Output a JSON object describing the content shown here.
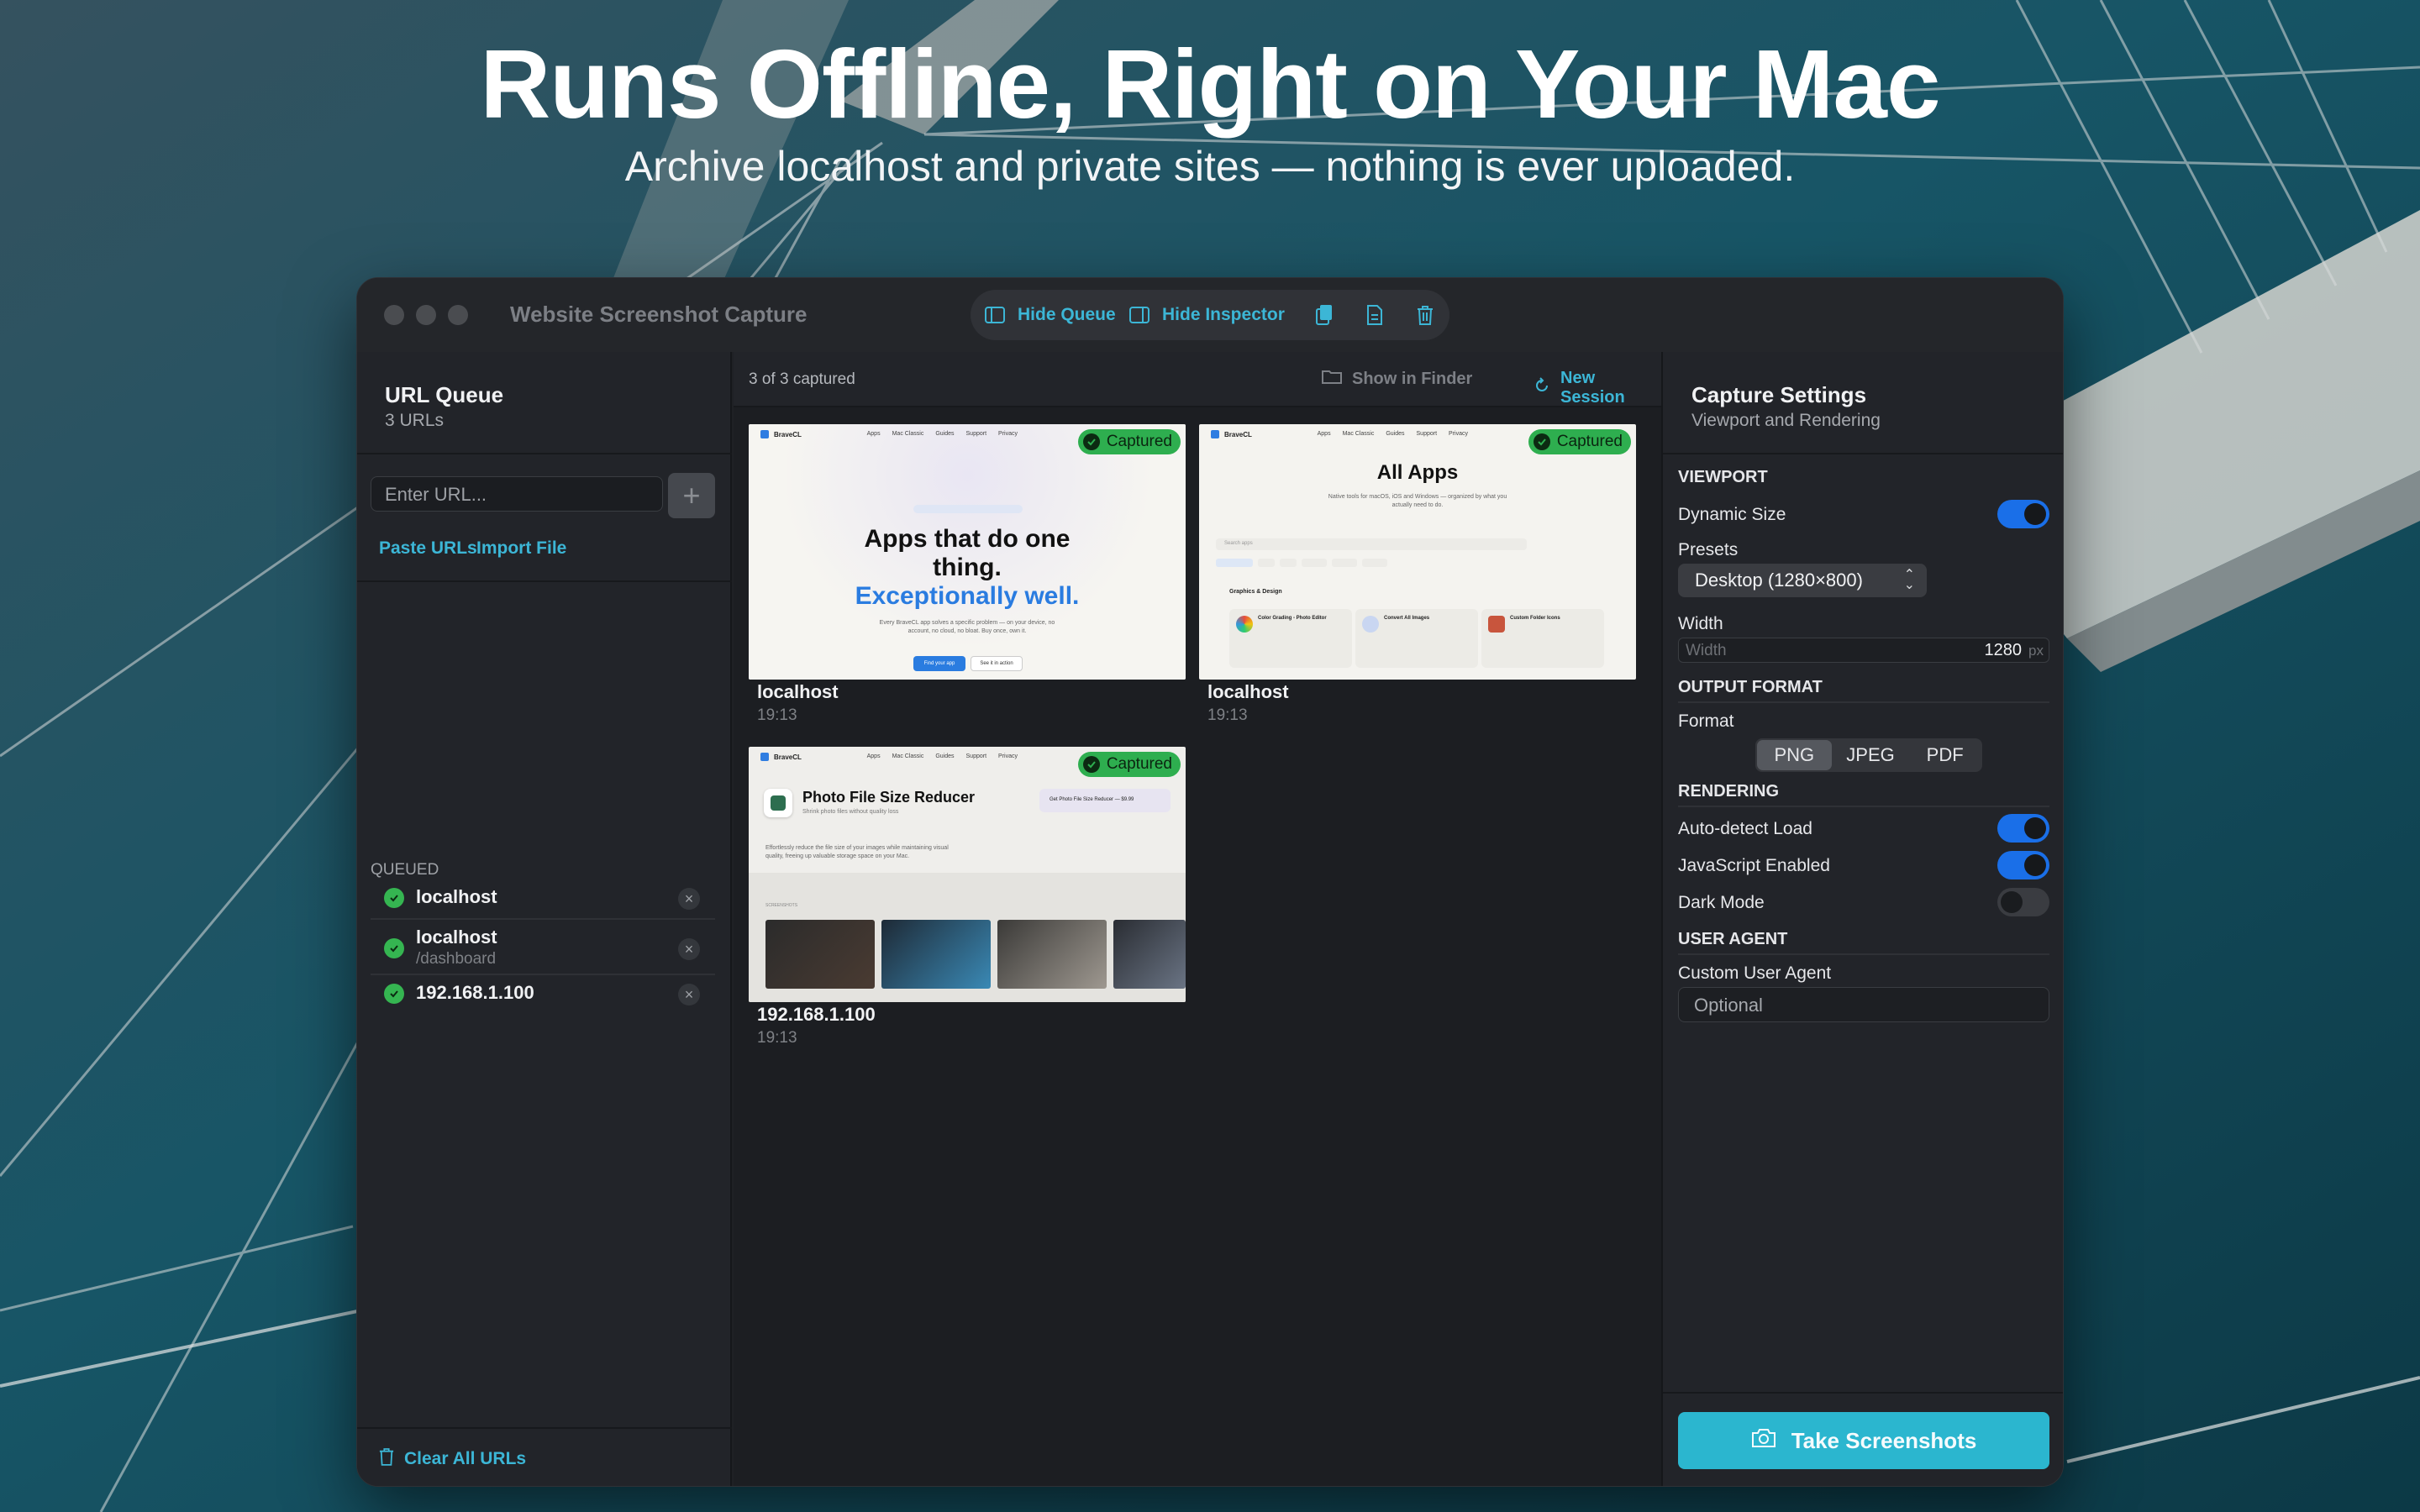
{
  "hero": {
    "title": "Runs Offline, Right on Your Mac",
    "subtitle": "Archive localhost and private sites — nothing is ever uploaded."
  },
  "window": {
    "title": "Website Screenshot Capture",
    "toolbar": {
      "hide_queue": "Hide Queue",
      "hide_inspector": "Hide Inspector",
      "icons": [
        "copy-icon",
        "document-icon",
        "trash-icon"
      ]
    }
  },
  "sidebar": {
    "title": "URL Queue",
    "subtitle": "3 URLs",
    "input_placeholder": "Enter URL...",
    "paste_urls": "Paste URLs",
    "import_file": "Import File",
    "queued_label": "QUEUED",
    "items": [
      {
        "host": "localhost",
        "path": ""
      },
      {
        "host": "localhost",
        "path": "/dashboard"
      },
      {
        "host": "192.168.1.100",
        "path": ""
      }
    ],
    "clear_all": "Clear All URLs"
  },
  "center": {
    "count": "3 of 3 captured",
    "show_in_finder": "Show in Finder",
    "new_session": "New Session",
    "cards": [
      {
        "host": "localhost",
        "time": "19:13",
        "badge": "Captured",
        "preview": {
          "brand": "BraveCL",
          "nav": [
            "Apps",
            "Mac Classic",
            "Guides",
            "Support",
            "Privacy"
          ],
          "headline1": "Apps that do one",
          "headline2": "thing.",
          "headline3": "Exceptionally well.",
          "body": "Every BraveCL app solves a specific problem — on your device, no account, no cloud, no bloat. Buy once, own it.",
          "btn1": "Find your app",
          "btn2": "See it in action"
        }
      },
      {
        "host": "localhost",
        "time": "19:13",
        "badge": "Captured",
        "preview": {
          "brand": "BraveCL",
          "nav": [
            "Apps",
            "Mac Classic",
            "Guides",
            "Support",
            "Privacy"
          ],
          "headline": "All Apps",
          "body": "Native tools for macOS, iOS and Windows — organized by what you actually need to do.",
          "search": "Search apps",
          "section": "Graphics & Design",
          "apps": [
            "Color Grading - Photo Editor",
            "Convert All Images",
            "Custom Folder Icons"
          ]
        }
      },
      {
        "host": "192.168.1.100",
        "time": "19:13",
        "badge": "Captured",
        "preview": {
          "brand": "BraveCL",
          "nav": [
            "Apps",
            "Mac Classic",
            "Guides",
            "Support",
            "Privacy"
          ],
          "headline": "Photo File Size Reducer",
          "tagline": "Shrink photo files without quality loss",
          "body": "Effortlessly reduce the file size of your images while maintaining visual quality, freeing up valuable storage space on your Mac.",
          "store_btn": "Get Photo File Size Reducer — $9.99",
          "screenshots_label": "SCREENSHOTS"
        }
      }
    ]
  },
  "inspector": {
    "title": "Capture Settings",
    "subtitle": "Viewport and Rendering",
    "viewport": "VIEWPORT",
    "dynamic_size": "Dynamic Size",
    "dynamic_size_on": true,
    "presets_label": "Presets",
    "preset_value": "Desktop (1280×800)",
    "width_label": "Width",
    "width_placeholder": "Width",
    "width_value": "1280",
    "width_unit": "px",
    "output_format": "OUTPUT FORMAT",
    "format_label": "Format",
    "formats": [
      "PNG",
      "JPEG",
      "PDF"
    ],
    "format_selected": "PNG",
    "rendering": "RENDERING",
    "auto_detect": "Auto-detect Load",
    "auto_detect_on": true,
    "javascript": "JavaScript Enabled",
    "javascript_on": true,
    "dark_mode": "Dark Mode",
    "dark_mode_on": false,
    "user_agent": "USER AGENT",
    "custom_ua_label": "Custom User Agent",
    "custom_ua_placeholder": "Optional",
    "take_screenshots": "Take Screenshots"
  },
  "colors": {
    "accent": "#3cb6d6",
    "toggle_on": "#1a6fe8",
    "success": "#2eae4f",
    "primary_button": "#2bb6cf"
  }
}
